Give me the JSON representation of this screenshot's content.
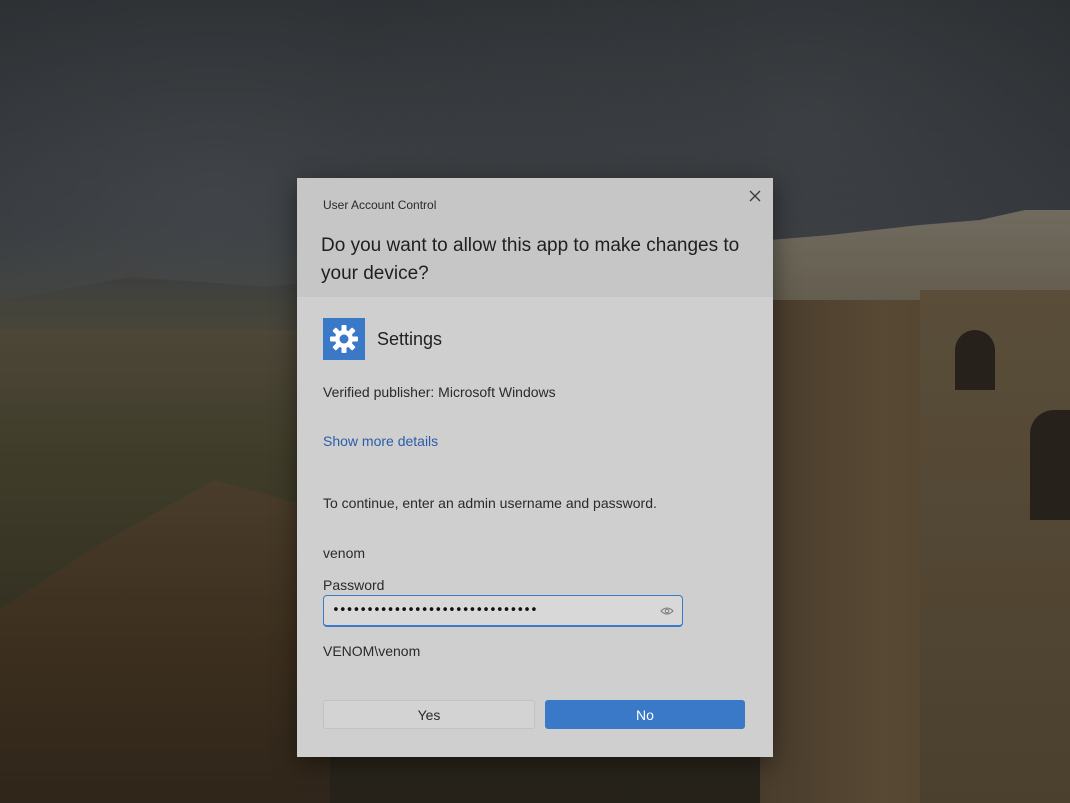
{
  "dialog": {
    "title": "User Account Control",
    "question": "Do you want to allow this app to make changes to your device?",
    "close_icon": "close-icon",
    "app": {
      "icon": "gear-icon",
      "name": "Settings"
    },
    "publisher": "Verified publisher: Microsoft Windows",
    "details_link": "Show more details",
    "instruction": "To continue, enter an admin username and password.",
    "username": "venom",
    "password": {
      "label": "Password",
      "value": "••••••••••••••••••••••••••••••",
      "reveal_icon": "eye-icon"
    },
    "domain_user": "VENOM\\venom",
    "buttons": {
      "yes": "Yes",
      "no": "No"
    }
  },
  "colors": {
    "accent": "#3a78c8",
    "link": "#2a5da8",
    "dialog_bg": "#cfcfcf"
  }
}
